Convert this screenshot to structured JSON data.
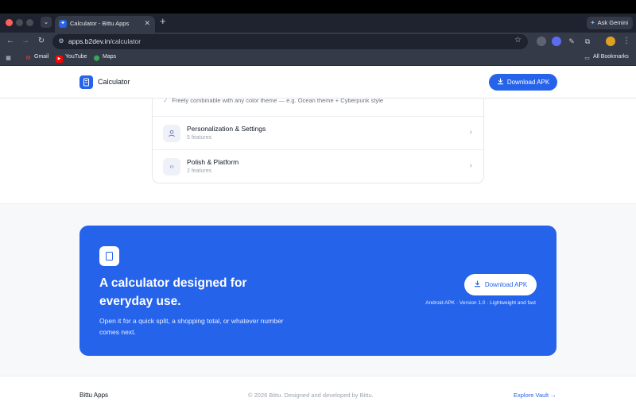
{
  "browser": {
    "tab_title": "Calculator - Bittu Apps",
    "url_host": "apps.b2dev.in",
    "url_path": "/calculator",
    "gemini_label": "Ask Gemini",
    "bookmarks": [
      {
        "label": "Gmail",
        "icon": "gmail-icon"
      },
      {
        "label": "YouTube",
        "icon": "youtube-icon"
      },
      {
        "label": "Maps",
        "icon": "maps-icon"
      }
    ],
    "all_bookmarks": "All Bookmarks"
  },
  "header": {
    "brand": "Calculator",
    "download_label": "Download APK"
  },
  "features": {
    "check_line": "Freely combinable with any color theme — e.g. Ocean theme + Cyberpunk style",
    "rows": [
      {
        "title": "Personalization & Settings",
        "sub": "5 features",
        "icon": "user-icon"
      },
      {
        "title": "Polish & Platform",
        "sub": "2 features",
        "icon": "code-icon"
      }
    ]
  },
  "cta": {
    "title": "A calculator designed for everyday use.",
    "description": "Open it for a quick split, a shopping total, or whatever number comes next.",
    "button_label": "Download APK",
    "meta": "Android APK · Version 1.0 · Lightweight and fast"
  },
  "footer": {
    "brand": "Bittu Apps",
    "copyright": "© 2026 Bittu. Designed and developed by Bittu.",
    "link": "Explore Vault →"
  },
  "colors": {
    "accent": "#2563eb",
    "chrome_dark": "#1f2330",
    "chrome_mid": "#353a48"
  }
}
